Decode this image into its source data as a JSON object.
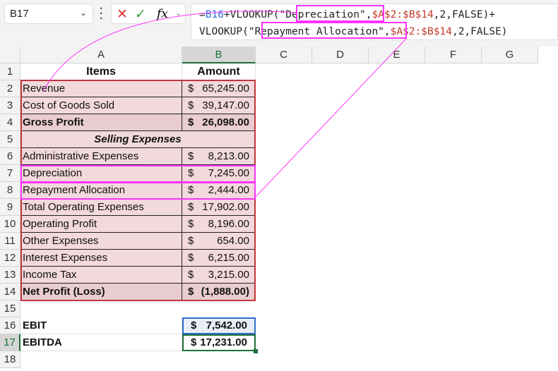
{
  "name_box": "B17",
  "formula_bar": {
    "cancel_icon": "✕",
    "enter_icon": "✓",
    "fx_label": "fx",
    "line1": {
      "p1": "=",
      "ref": "B16",
      "p2": "+VLOOKUP(\"",
      "key": "Depreciation",
      "p3": "\",",
      "range": "$A$2:$B$14",
      "p4": ",2,FALSE)+"
    },
    "line2": {
      "p1": "VLOOKUP(\"",
      "key": "Repayment Allocation",
      "p3": "\",",
      "range": "$A$2:$B$14",
      "p4": ",2,FALSE)"
    }
  },
  "columns": [
    "A",
    "B",
    "C",
    "D",
    "E",
    "F",
    "G"
  ],
  "rows": [
    "1",
    "2",
    "3",
    "4",
    "5",
    "6",
    "7",
    "8",
    "9",
    "10",
    "11",
    "12",
    "13",
    "14",
    "15",
    "16",
    "17",
    "18"
  ],
  "headers": {
    "items": "Items",
    "amount": "Amount"
  },
  "section": "Selling Expenses",
  "table": [
    {
      "item": "Revenue",
      "cur": "$",
      "amt": "65,245.00"
    },
    {
      "item": "Cost of Goods Sold",
      "cur": "$",
      "amt": "39,147.00"
    },
    {
      "item": "Gross Profit",
      "cur": "$",
      "amt": "26,098.00"
    },
    null,
    {
      "item": "Administrative Expenses",
      "cur": "$",
      "amt": "8,213.00"
    },
    {
      "item": "Depreciation",
      "cur": "$",
      "amt": "7,245.00"
    },
    {
      "item": "Repayment Allocation",
      "cur": "$",
      "amt": "2,444.00"
    },
    {
      "item": "Total Operating Expenses",
      "cur": "$",
      "amt": "17,902.00"
    },
    {
      "item": "Operating Profit",
      "cur": "$",
      "amt": "8,196.00"
    },
    {
      "item": "Other Expenses",
      "cur": "$",
      "amt": "654.00"
    },
    {
      "item": "Interest Expenses",
      "cur": "$",
      "amt": "6,215.00"
    },
    {
      "item": "Income Tax",
      "cur": "$",
      "amt": "3,215.00"
    },
    {
      "item": "Net Profit (Loss)",
      "cur": "$",
      "amt": "(1,888.00)"
    }
  ],
  "results": [
    {
      "label": "EBIT",
      "cur": "$",
      "amt": "7,542.00"
    },
    {
      "label": "EBITDA",
      "cur": "$",
      "amt": "17,231.00"
    }
  ],
  "colors": {
    "highlight": "#ff33ff",
    "table_fill": "#f2d9db",
    "selection": "#1e6e3a"
  }
}
